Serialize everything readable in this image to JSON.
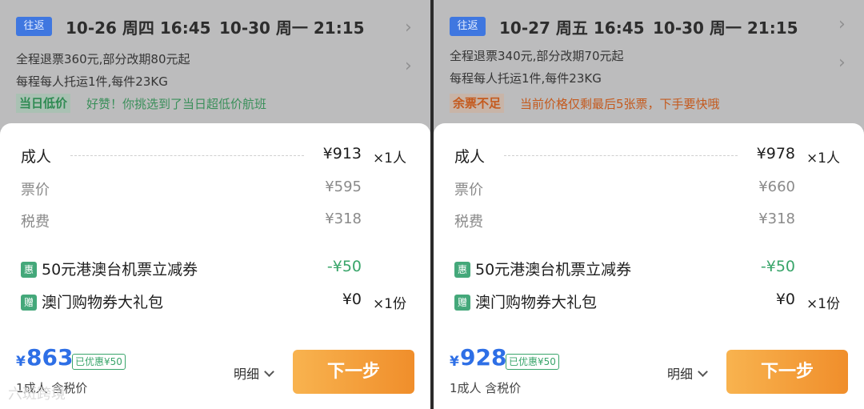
{
  "left": {
    "trip_tag": "往返",
    "depart": "10-26 周四 16:45",
    "return": "10-30 周一 21:15",
    "refund_rule": "全程退票360元,部分改期80元起",
    "baggage_rule": "每程每人托运1件,每件23KG",
    "badge": "当日低价",
    "badge_msg": "好赞！你挑选到了当日超低价航班",
    "adult_label": "成人",
    "adult_price": "¥913",
    "adult_qty": "×1人",
    "fare_label": "票价",
    "fare_value": "¥595",
    "tax_label": "税费",
    "tax_value": "¥318",
    "coupon_icon": "惠",
    "coupon_label": "50元港澳台机票立减券",
    "coupon_value": "-¥50",
    "gift_icon": "赠",
    "gift_label": "澳门购物券大礼包",
    "gift_value": "¥0",
    "gift_qty": "×1份",
    "currency": "¥",
    "total": "863",
    "saved": "已优惠¥50",
    "total_sub": "1成人 含税价",
    "detail": "明细",
    "next": "下一步"
  },
  "right": {
    "trip_tag": "往返",
    "depart": "10-27 周五 16:45",
    "return": "10-30 周一 21:15",
    "refund_rule": "全程退票340元,部分改期70元起",
    "baggage_rule": "每程每人托运1件,每件23KG",
    "badge": "余票不足",
    "badge_msg": "当前价格仅剩最后5张票，下手要快哦",
    "adult_label": "成人",
    "adult_price": "¥978",
    "adult_qty": "×1人",
    "fare_label": "票价",
    "fare_value": "¥660",
    "tax_label": "税费",
    "tax_value": "¥318",
    "coupon_icon": "惠",
    "coupon_label": "50元港澳台机票立减券",
    "coupon_value": "-¥50",
    "gift_icon": "赠",
    "gift_label": "澳门购物券大礼包",
    "gift_value": "¥0",
    "gift_qty": "×1份",
    "currency": "¥",
    "total": "928",
    "saved": "已优惠¥50",
    "total_sub": "1成人 含税价",
    "detail": "明细",
    "next": "下一步"
  },
  "watermark": "六斑跨境",
  "colors": {
    "accent_blue": "#2e6fe6",
    "cta_orange": "#f08e2b",
    "green": "#39a56a",
    "warn_orange": "#c45a1e"
  }
}
